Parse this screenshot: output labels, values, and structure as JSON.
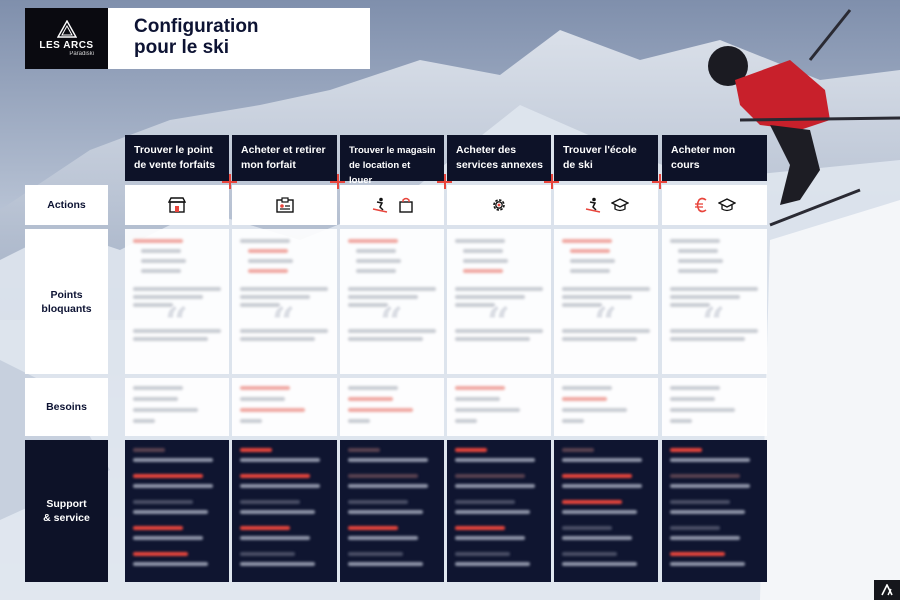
{
  "brand": {
    "name": "LES ARCS",
    "subname": "Paradiski"
  },
  "title": {
    "line1": "Configuration",
    "line2": "pour le ski"
  },
  "stages": [
    {
      "label": "Trouver le point de vente forfaits"
    },
    {
      "label": "Acheter et retirer mon forfait"
    },
    {
      "label": "Trouver le magasin de location et louer"
    },
    {
      "label": "Acheter des services annexes"
    },
    {
      "label": "Trouver l'école de ski"
    },
    {
      "label": "Acheter mon cours"
    }
  ],
  "rows": {
    "actions": "Actions",
    "pain_points": "Points bloquants",
    "needs": "Besoins",
    "support": "Support & service"
  },
  "action_icons": [
    [
      "store-icon"
    ],
    [
      "ticket-icon"
    ],
    [
      "skier-icon",
      "shopping-bag-icon"
    ],
    [
      "gear-icon"
    ],
    [
      "skier-icon",
      "graduation-cap-icon"
    ],
    [
      "euro-icon",
      "graduation-cap-icon"
    ]
  ],
  "colors": {
    "navy": "#0d1228",
    "accent_red": "#e8453c",
    "white": "#ffffff"
  }
}
